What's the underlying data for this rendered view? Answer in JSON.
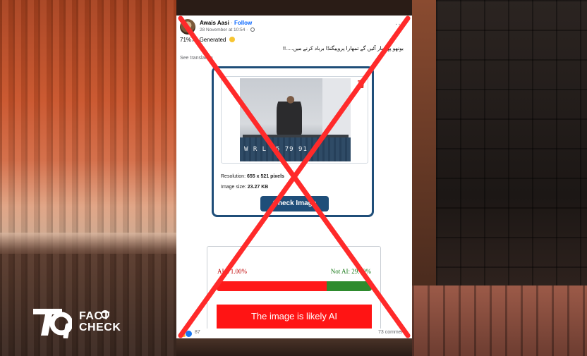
{
  "post": {
    "author": "Awais Aasi",
    "separator": "·",
    "follow_label": "Follow",
    "timestamp": "28 November at 10:54",
    "meta_separator": "·",
    "caption": "71% AI Generated",
    "caption_emoji": "grinning-face-emoji",
    "urdu_text": "بونھو پھر بار آئیں گے تمھارا پروپیگنڈا برباد کرنے میں.....!!",
    "see_translation": "See translation",
    "more_icon": "···"
  },
  "tool": {
    "photo_code": "W R L  05  79 91",
    "resolution_label": "Resolution:",
    "resolution_value": "655 x 521 pixels",
    "size_label": "Image size:",
    "size_value": "23.27 KB",
    "check_button": "Check Image"
  },
  "result": {
    "ai_label": "AI: 71.00%",
    "notai_label": "Not AI: 29.00%",
    "ai_fraction": 0.71,
    "verdict": "The image is likely AI"
  },
  "footer": {
    "reaction_count": "87",
    "comments": "73 comments"
  },
  "logo": {
    "fact": "FACT",
    "check": "CHECK"
  },
  "colors": {
    "cross": "#ff2a2a",
    "ai_red": "#ff1a1a",
    "notai_green": "#2e8b2e",
    "button_blue": "#1f4e79",
    "follow_blue": "#0866ff"
  }
}
